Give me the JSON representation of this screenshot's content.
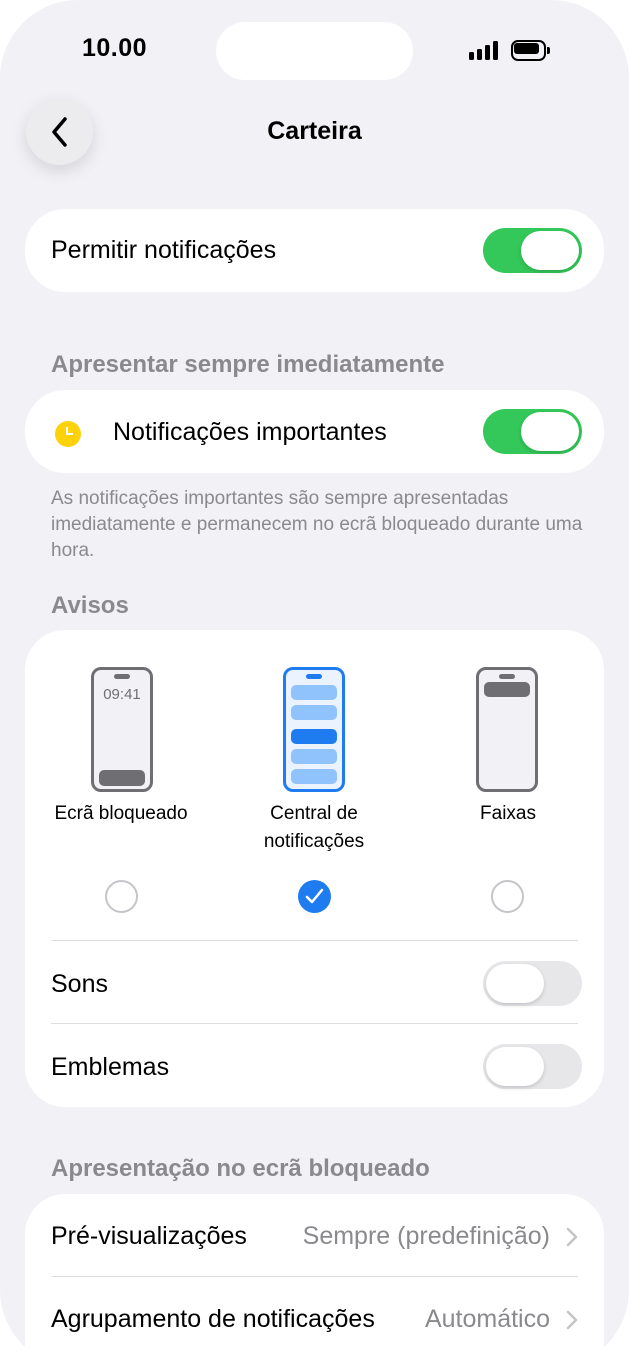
{
  "status_bar": {
    "time": "10.00"
  },
  "nav": {
    "title": "Carteira",
    "back_icon": "chevron-left-icon"
  },
  "allow_notifications": {
    "label": "Permitir notificações",
    "enabled": true
  },
  "immediate_section": {
    "header": "Apresentar sempre imediatamente",
    "item_label": "Notificações importantes",
    "item_icon": "clock-icon",
    "enabled": true,
    "footnote": "As notificações importantes são sempre apresentadas imediatamente e permanecem no ecrã bloqueado durante uma hora."
  },
  "alerts_section": {
    "header": "Avisos",
    "styles": [
      {
        "label": "Ecrã bloqueado",
        "preview_time": "09:41",
        "selected": false
      },
      {
        "label": "Central de notificações",
        "selected": true
      },
      {
        "label": "Faixas",
        "selected": false
      }
    ],
    "sounds": {
      "label": "Sons",
      "enabled": false
    },
    "badges": {
      "label": "Emblemas",
      "enabled": false
    }
  },
  "lock_screen_section": {
    "header": "Apresentação no ecrã bloqueado",
    "previews": {
      "label": "Pré-visualizações",
      "value": "Sempre (predefinição)"
    },
    "grouping": {
      "label": "Agrupamento de notificações",
      "value": "Automático"
    }
  },
  "colors": {
    "accent": "#1f7cf0",
    "toggle_on": "#34c759",
    "background": "#f2f1f6",
    "secondary_text": "#8a8a8e",
    "important_icon": "#fdd20a"
  }
}
